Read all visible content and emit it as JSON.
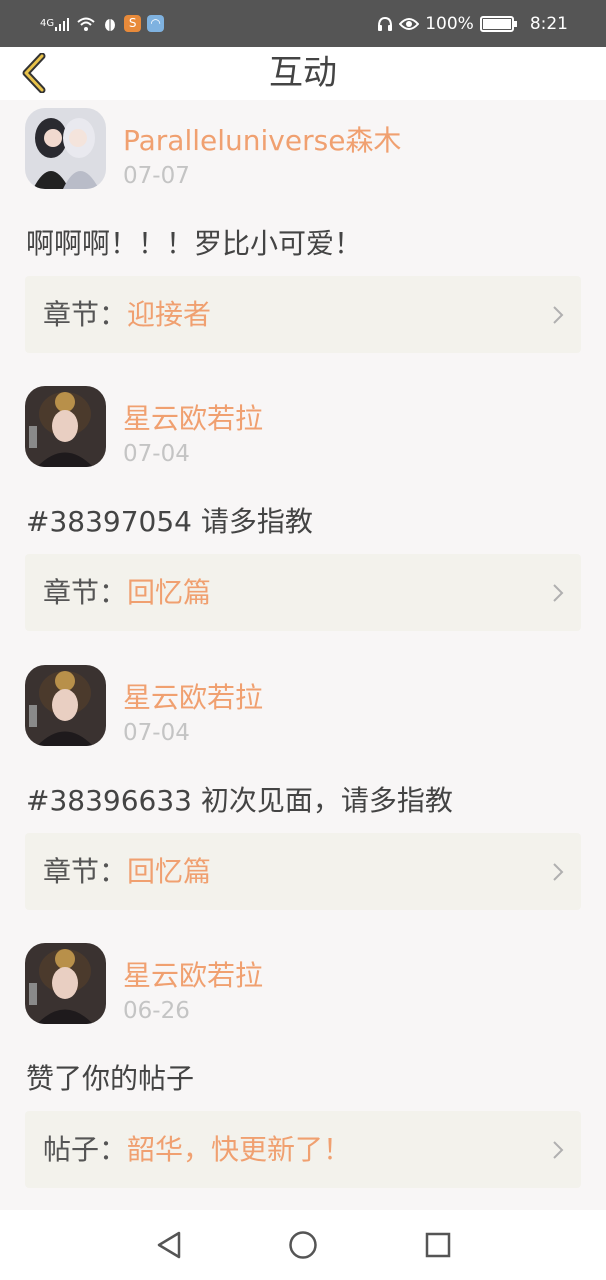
{
  "status_bar": {
    "signal_text": "4G",
    "battery_percent": "100%",
    "time": "8:21",
    "app_icons": [
      "sohu-app-icon",
      "browser-app-icon"
    ]
  },
  "header": {
    "title": "互动"
  },
  "colors": {
    "accent": "#f0a070",
    "status_bar_bg": "#555555",
    "chapter_bg": "#f3f2ec",
    "page_bg": "#f8f6f6"
  },
  "feed": [
    {
      "user": "Paralleluniverse森木",
      "date": "07-07",
      "content": "啊啊啊！！！罗比小可爱！",
      "link_label": "章节：",
      "link_value": "迎接者"
    },
    {
      "user": "星云欧若拉",
      "date": "07-04",
      "content": "#38397054 请多指教",
      "link_label": "章节：",
      "link_value": "回忆篇"
    },
    {
      "user": "星云欧若拉",
      "date": "07-04",
      "content": "#38396633 初次见面，请多指教",
      "link_label": "章节：",
      "link_value": "回忆篇"
    },
    {
      "user": "星云欧若拉",
      "date": "06-26",
      "content": "赞了你的帖子",
      "link_label": "帖子：",
      "link_value": "韶华，快更新了！"
    }
  ],
  "nav_bar": {
    "icons": [
      "back-triangle-icon",
      "home-circle-icon",
      "recents-square-icon"
    ]
  }
}
